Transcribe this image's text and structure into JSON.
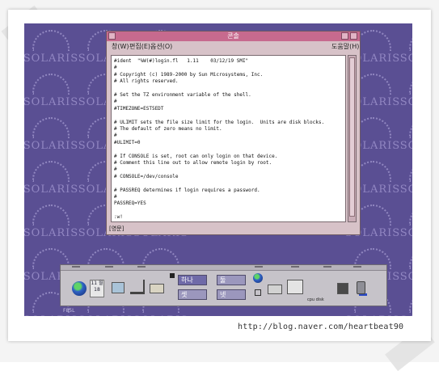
{
  "watermark": {
    "url": "http://blog.naver.com/heartbeat90"
  },
  "desktop": {
    "logo_word": "SOLARIS",
    "bottom_text": "F85L"
  },
  "terminal": {
    "title": "콘솔",
    "menu": {
      "window": "창(W)",
      "edit": "편집(E)",
      "options": "옵션(O)",
      "help": "도움말(H)"
    },
    "lines": [
      "#ident  \"%W(#)login.fl   1.11    03/12/19 SMI\"",
      "#",
      "# Copyright (c) 1989-2000 by Sun Microsystems, Inc.",
      "# All rights reserved.",
      "",
      "# Set the TZ environment variable of the shell.",
      "#",
      "#TIMEZONE=EST5EDT",
      "",
      "# ULIMIT sets the file size limit for the login.  Units are disk blocks.",
      "# The default of zero means no limit.",
      "#",
      "#ULIMIT=0",
      "",
      "# If CONSOLE is set, root can only login on that device.",
      "# Comment this line out to allow remote login by root.",
      "#",
      "# CONSOLE=/dev/console",
      "",
      "# PASSREQ determines if login requires a password.",
      "#",
      "PASSREQ=YES",
      "",
      ":w!"
    ],
    "status": "[영문]"
  },
  "panel": {
    "date_top": "11 월",
    "date_day": "18",
    "workspaces": [
      "하나",
      "둘",
      "셋",
      "넷"
    ],
    "meter_label": "cpu disk"
  }
}
